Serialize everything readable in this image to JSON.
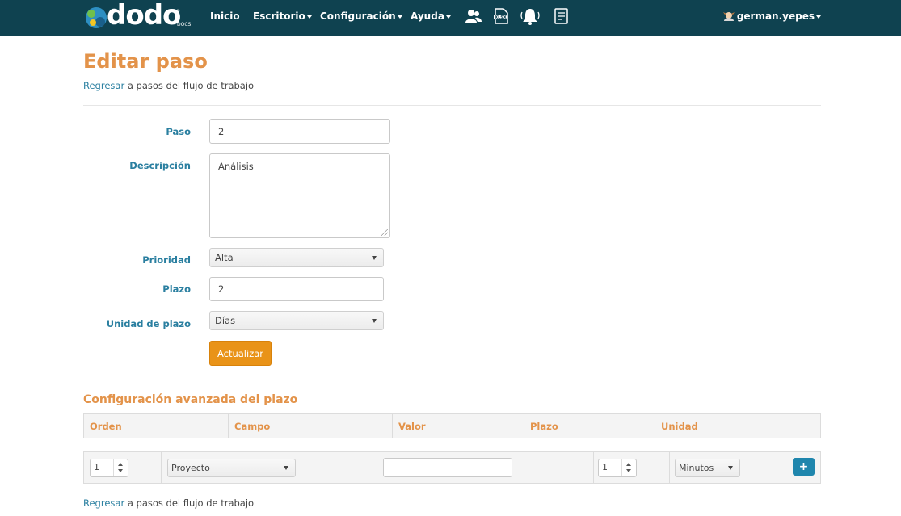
{
  "nav": {
    "logo_text": "dodo",
    "logo_sub": "DOCS",
    "logo_reg": "®",
    "items": [
      {
        "label": "Inicio",
        "dropdown": false
      },
      {
        "label": "Escritorio",
        "dropdown": true
      },
      {
        "label": "Configuración",
        "dropdown": true
      },
      {
        "label": "Ayuda",
        "dropdown": true
      }
    ],
    "icons": [
      "users-icon",
      "xlsx-file-icon",
      "bell-icon",
      "document-list-icon"
    ],
    "user": "german.yepes",
    "bar_color": "#0f4250"
  },
  "page": {
    "title": "Editar paso",
    "back_link": "Regresar",
    "back_text": " a pasos del flujo de trabajo"
  },
  "form": {
    "paso_label": "Paso",
    "paso_value": "2",
    "descripcion_label": "Descripción",
    "descripcion_value": "Análisis",
    "prioridad_label": "Prioridad",
    "prioridad_value": "Alta",
    "plazo_label": "Plazo",
    "plazo_value": "2",
    "unidad_label": "Unidad de plazo",
    "unidad_value": "Días",
    "submit_label": "Actualizar"
  },
  "advanced": {
    "title": "Configuración avanzada del plazo",
    "columns": [
      "Orden",
      "Campo",
      "Valor",
      "Plazo",
      "Unidad"
    ],
    "row": {
      "orden": "1",
      "campo": "Proyecto",
      "valor": "",
      "plazo": "1",
      "unidad": "Minutos",
      "add_label": "+"
    }
  },
  "colors": {
    "accent_orange": "#e3934a",
    "label_blue": "#2a7fa0",
    "button_orange": "#e99318",
    "button_blue": "#1f86ad"
  }
}
